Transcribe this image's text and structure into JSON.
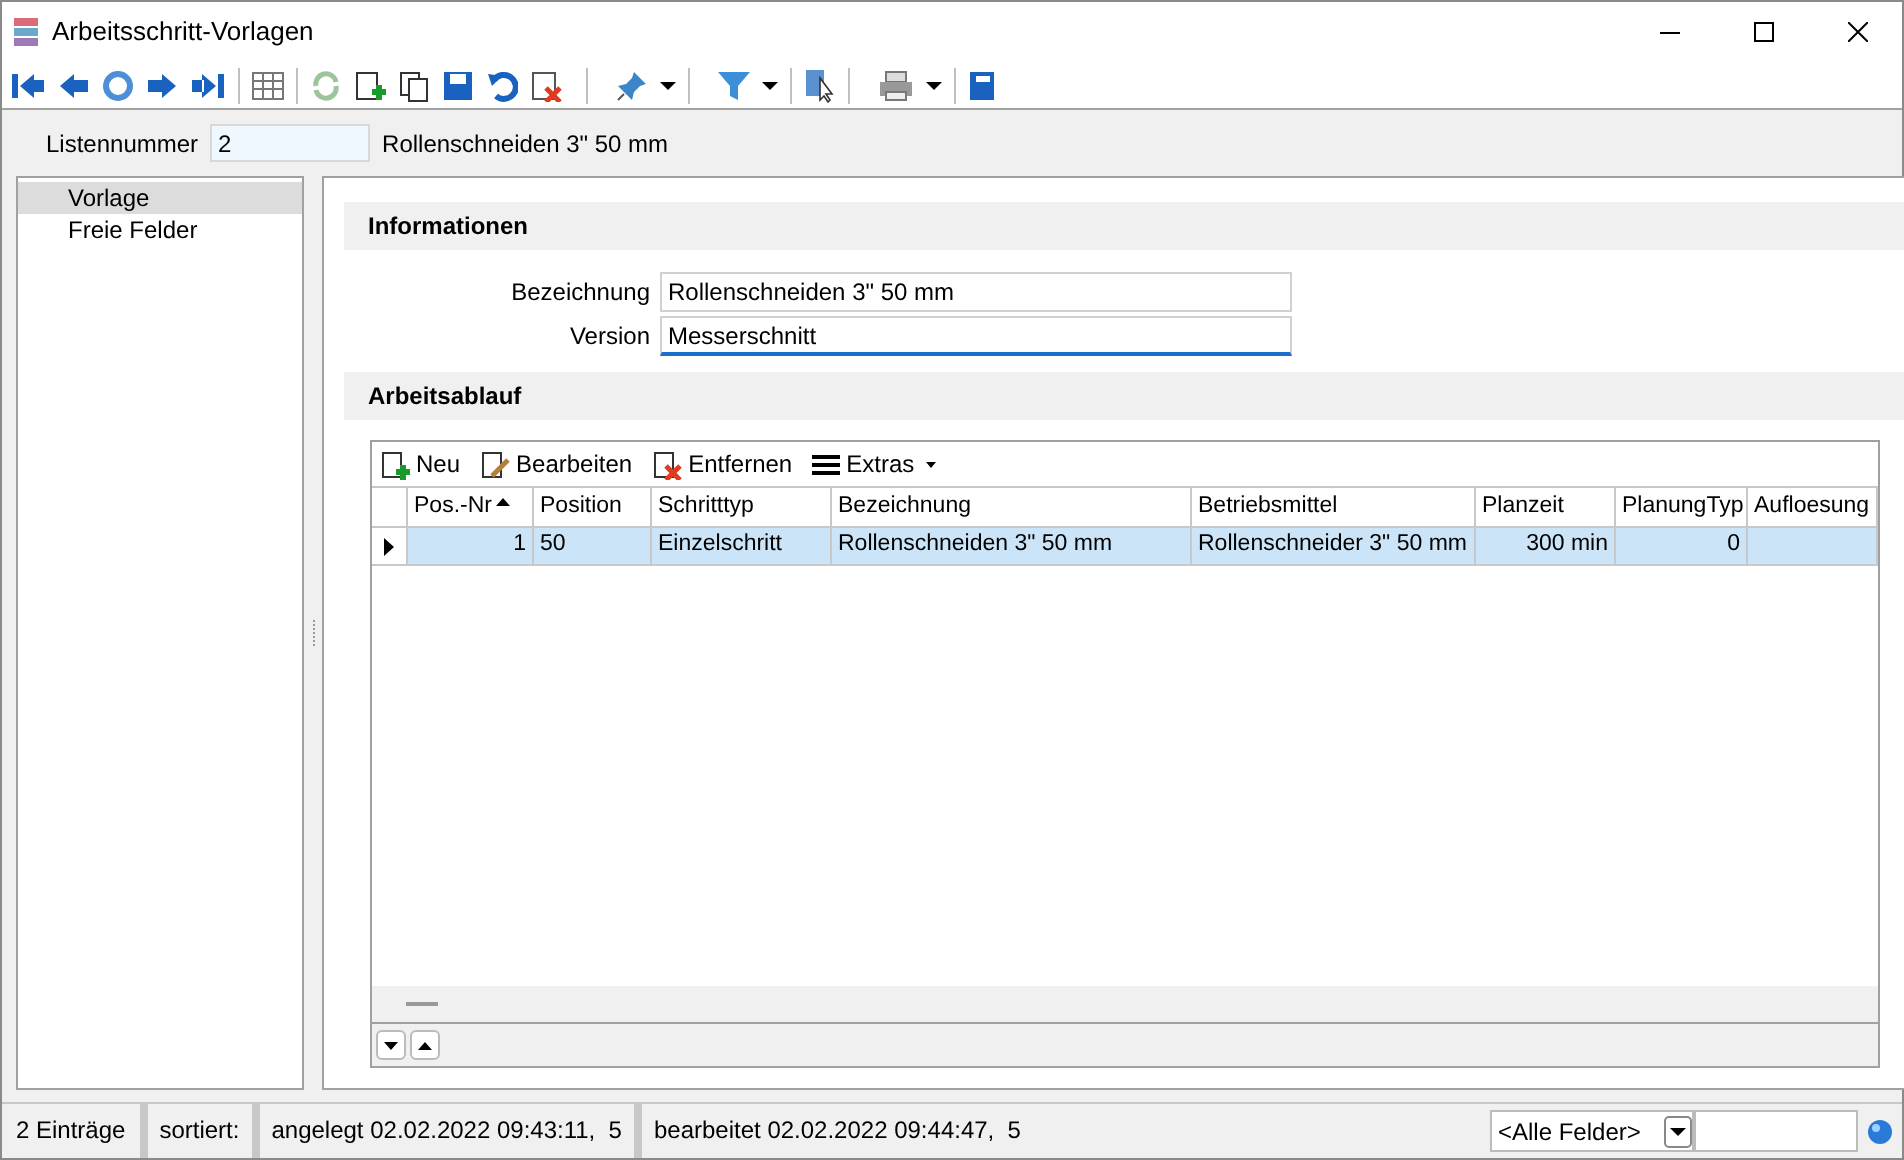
{
  "window": {
    "title": "Arbeitsschritt-Vorlagen"
  },
  "header": {
    "label": "Listennummer",
    "value": "2",
    "description": "Rollenschneiden 3\" 50 mm"
  },
  "sidebar": {
    "items": [
      {
        "label": "Vorlage",
        "selected": true
      },
      {
        "label": "Freie Felder",
        "selected": false
      }
    ]
  },
  "informationen": {
    "title": "Informationen",
    "fields": [
      {
        "label": "Bezeichnung",
        "value": "Rollenschneiden 3\" 50 mm",
        "focused": false
      },
      {
        "label": "Version",
        "value": "Messerschnitt",
        "focused": true
      }
    ]
  },
  "arbeitsablauf": {
    "title": "Arbeitsablauf",
    "toolbar": [
      {
        "kind": "new",
        "label": "Neu"
      },
      {
        "kind": "edit",
        "label": "Bearbeiten"
      },
      {
        "kind": "delete",
        "label": "Entfernen"
      },
      {
        "kind": "menu",
        "label": "Extras"
      }
    ],
    "columns": [
      {
        "label": "Pos.-Nr",
        "sorted": true
      },
      {
        "label": "Position",
        "sorted": false
      },
      {
        "label": "Schritttyp",
        "sorted": false
      },
      {
        "label": "Bezeichnung",
        "sorted": false
      },
      {
        "label": "Betriebsmittel",
        "sorted": false
      },
      {
        "label": "Planzeit",
        "sorted": false
      },
      {
        "label": "PlanungTyp",
        "sorted": false
      },
      {
        "label": "Aufloesung",
        "sorted": false
      }
    ],
    "rows": [
      {
        "selected": true,
        "cells": [
          "1",
          "50",
          "Einzelschritt",
          "Rollenschneiden 3\" 50 mm",
          "Rollenschneider 3\" 50 mm",
          "300 min",
          "0",
          ""
        ]
      }
    ]
  },
  "status_bar": {
    "count": "2 Einträge",
    "sorted": "sortiert:",
    "created": "angelegt 02.02.2022 09:43:11,  5",
    "edited": "bearbeitet 02.02.2022 09:44:47,  5",
    "filter": "<Alle Felder>"
  }
}
